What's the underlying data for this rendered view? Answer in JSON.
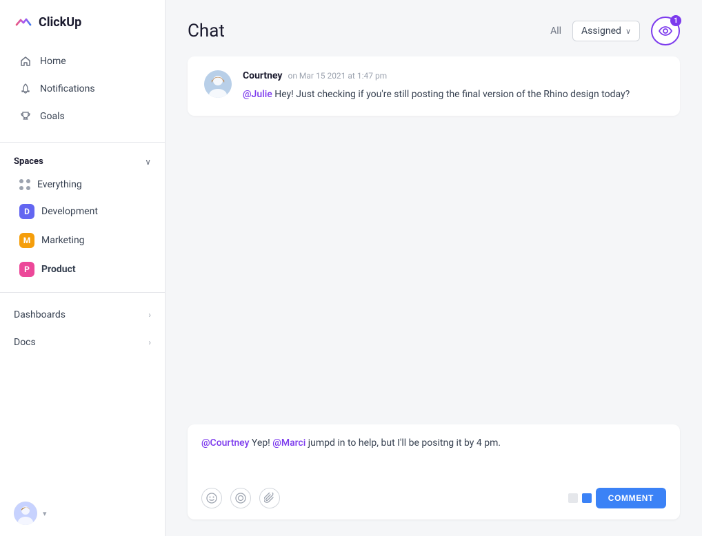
{
  "app": {
    "logo_text": "ClickUp"
  },
  "sidebar": {
    "nav_items": [
      {
        "id": "home",
        "label": "Home",
        "icon": "home"
      },
      {
        "id": "notifications",
        "label": "Notifications",
        "icon": "bell"
      },
      {
        "id": "goals",
        "label": "Goals",
        "icon": "trophy"
      }
    ],
    "spaces_label": "Spaces",
    "spaces": [
      {
        "id": "everything",
        "label": "Everything",
        "type": "dots"
      },
      {
        "id": "development",
        "label": "Development",
        "badge": "D",
        "color": "#6366f1"
      },
      {
        "id": "marketing",
        "label": "Marketing",
        "badge": "M",
        "color": "#f59e0b"
      },
      {
        "id": "product",
        "label": "Product",
        "badge": "P",
        "color": "#ec4899",
        "active": true
      }
    ],
    "sections": [
      {
        "id": "dashboards",
        "label": "Dashboards"
      },
      {
        "id": "docs",
        "label": "Docs"
      }
    ],
    "user_chevron": "▾"
  },
  "chat": {
    "title": "Chat",
    "filter_all": "All",
    "filter_assigned": "Assigned",
    "notification_count": "1"
  },
  "messages": [
    {
      "id": "msg1",
      "author": "Courtney",
      "time": "on Mar 15 2021 at 1:47 pm",
      "mention": "@Julie",
      "body": " Hey! Just checking if you're still posting the final version of the Rhino design today?"
    }
  ],
  "reply": {
    "mention1": "@Courtney",
    "text1": " Yep! ",
    "mention2": "@Marci",
    "text2": " jumpd in to help, but I'll be positng it by 4 pm.",
    "comment_btn": "COMMENT"
  }
}
